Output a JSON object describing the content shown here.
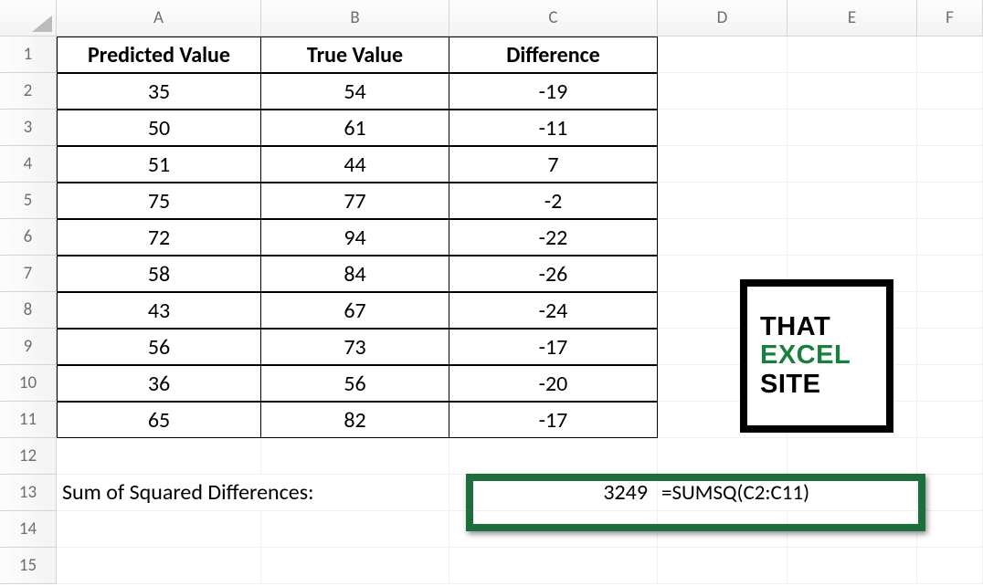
{
  "columns": [
    "A",
    "B",
    "C",
    "D",
    "E",
    "F"
  ],
  "row_headers": [
    "1",
    "2",
    "3",
    "4",
    "5",
    "6",
    "7",
    "8",
    "9",
    "10",
    "11",
    "12",
    "13",
    "14",
    "15"
  ],
  "table": {
    "headers": {
      "a": "Predicted Value",
      "b": "True Value",
      "c": "Difference"
    },
    "rows": [
      {
        "a": "35",
        "b": "54",
        "c": "-19"
      },
      {
        "a": "50",
        "b": "61",
        "c": "-11"
      },
      {
        "a": "51",
        "b": "44",
        "c": "7"
      },
      {
        "a": "75",
        "b": "77",
        "c": "-2"
      },
      {
        "a": "72",
        "b": "94",
        "c": "-22"
      },
      {
        "a": "58",
        "b": "84",
        "c": "-26"
      },
      {
        "a": "43",
        "b": "67",
        "c": "-24"
      },
      {
        "a": "56",
        "b": "73",
        "c": "-17"
      },
      {
        "a": "36",
        "b": "56",
        "c": "-20"
      },
      {
        "a": "65",
        "b": "82",
        "c": "-17"
      }
    ]
  },
  "summary": {
    "label": "Sum of Squared Differences:",
    "value": "3249",
    "formula": "=SUMSQ(C2:C11)"
  },
  "logo": {
    "line1": "THAT",
    "line2": "EXCEL",
    "line3": "SITE"
  },
  "chart_data": {
    "type": "table",
    "title": "Predicted vs True values with differences and SUMSQ",
    "columns": [
      "Predicted Value",
      "True Value",
      "Difference"
    ],
    "rows": [
      [
        35,
        54,
        -19
      ],
      [
        50,
        61,
        -11
      ],
      [
        51,
        44,
        7
      ],
      [
        75,
        77,
        -2
      ],
      [
        72,
        94,
        -22
      ],
      [
        58,
        84,
        -26
      ],
      [
        43,
        67,
        -24
      ],
      [
        56,
        73,
        -17
      ],
      [
        36,
        56,
        -20
      ],
      [
        65,
        82,
        -17
      ]
    ],
    "sum_of_squared_differences": 3249,
    "formula": "=SUMSQ(C2:C11)"
  }
}
